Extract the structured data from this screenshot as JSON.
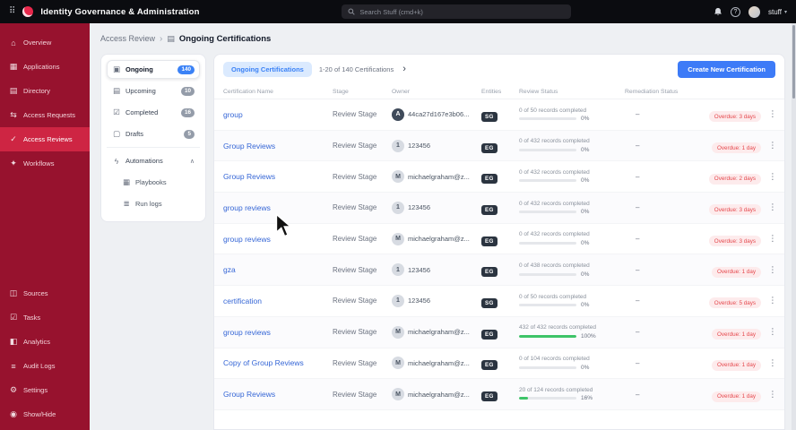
{
  "topbar": {
    "title": "Identity Governance & Administration",
    "search_placeholder": "Search Stuff (cmd+k)",
    "user_name": "stuff"
  },
  "sidebar": {
    "top": [
      {
        "label": "Overview",
        "icon": "overview-icon",
        "active": false
      },
      {
        "label": "Applications",
        "icon": "applications-icon",
        "active": false
      },
      {
        "label": "Directory",
        "icon": "directory-icon",
        "active": false
      },
      {
        "label": "Access Requests",
        "icon": "access-requests-icon",
        "active": false
      },
      {
        "label": "Access Reviews",
        "icon": "access-reviews-icon",
        "active": true
      },
      {
        "label": "Workflows",
        "icon": "workflows-icon",
        "active": false
      }
    ],
    "bottom": [
      {
        "label": "Sources",
        "icon": "sources-icon",
        "active": false
      },
      {
        "label": "Tasks",
        "icon": "tasks-icon",
        "active": false
      },
      {
        "label": "Analytics",
        "icon": "analytics-icon",
        "active": false
      },
      {
        "label": "Audit Logs",
        "icon": "audit-logs-icon",
        "active": false
      },
      {
        "label": "Settings",
        "icon": "settings-icon",
        "active": false
      },
      {
        "label": "Show/Hide",
        "icon": "show-hide-icon",
        "active": false
      }
    ]
  },
  "breadcrumb": {
    "parent": "Access Review",
    "current": "Ongoing Certifications"
  },
  "filters": {
    "items": [
      {
        "label": "Ongoing",
        "count": "140",
        "icon": "ongoing-icon",
        "active": true
      },
      {
        "label": "Upcoming",
        "count": "10",
        "icon": "upcoming-icon",
        "active": false
      },
      {
        "label": "Completed",
        "count": "16",
        "icon": "completed-icon",
        "active": false
      },
      {
        "label": "Drafts",
        "count": "5",
        "icon": "drafts-icon",
        "active": false
      }
    ],
    "automations": {
      "label": "Automations",
      "icon": "automations-icon",
      "expanded": true,
      "children": [
        {
          "label": "Playbooks",
          "icon": "playbooks-icon"
        },
        {
          "label": "Run logs",
          "icon": "runlogs-icon"
        }
      ]
    }
  },
  "table": {
    "tab_label": "Ongoing Certifications",
    "pagination": "1-20 of 140 Certifications",
    "create_button": "Create New Certification",
    "columns": [
      "Certification Name",
      "Stage",
      "Owner",
      "Entities",
      "Review Status",
      "Remediation Status"
    ],
    "rows": [
      {
        "name": "group",
        "stage": "Review Stage",
        "owner_initial": "A",
        "avatar_variant": "dark",
        "owner": "44ca27d167e3b06...",
        "entity": "SG",
        "review_text": "0 of 50 records completed",
        "percent": 0,
        "percent_label": "0%",
        "remediation": "–",
        "overdue": "Overdue: 3 days"
      },
      {
        "name": "Group Reviews",
        "stage": "Review Stage",
        "owner_initial": "1",
        "avatar_variant": "light",
        "owner": "123456",
        "entity": "EG",
        "review_text": "0 of 432 records completed",
        "percent": 0,
        "percent_label": "0%",
        "remediation": "–",
        "overdue": "Overdue: 1 day"
      },
      {
        "name": "Group Reviews",
        "stage": "Review Stage",
        "owner_initial": "M",
        "avatar_variant": "light",
        "owner": "michaelgraham@z...",
        "entity": "EG",
        "review_text": "0 of 432 records completed",
        "percent": 0,
        "percent_label": "0%",
        "remediation": "–",
        "overdue": "Overdue: 2 days"
      },
      {
        "name": "group reviews",
        "stage": "Review Stage",
        "owner_initial": "1",
        "avatar_variant": "light",
        "owner": "123456",
        "entity": "EG",
        "review_text": "0 of 432 records completed",
        "percent": 0,
        "percent_label": "0%",
        "remediation": "–",
        "overdue": "Overdue: 3 days"
      },
      {
        "name": "group reviews",
        "stage": "Review Stage",
        "owner_initial": "M",
        "avatar_variant": "light",
        "owner": "michaelgraham@z...",
        "entity": "EG",
        "review_text": "0 of 432 records completed",
        "percent": 0,
        "percent_label": "0%",
        "remediation": "–",
        "overdue": "Overdue: 3 days"
      },
      {
        "name": "gza",
        "stage": "Review Stage",
        "owner_initial": "1",
        "avatar_variant": "light",
        "owner": "123456",
        "entity": "EG",
        "review_text": "0 of 438 records completed",
        "percent": 0,
        "percent_label": "0%",
        "remediation": "–",
        "overdue": "Overdue: 1 day"
      },
      {
        "name": "certification",
        "stage": "Review Stage",
        "owner_initial": "1",
        "avatar_variant": "light",
        "owner": "123456",
        "entity": "SG",
        "review_text": "0 of 50 records completed",
        "percent": 0,
        "percent_label": "0%",
        "remediation": "–",
        "overdue": "Overdue: 5 days"
      },
      {
        "name": "group reviews",
        "stage": "Review Stage",
        "owner_initial": "M",
        "avatar_variant": "light",
        "owner": "michaelgraham@z...",
        "entity": "EG",
        "review_text": "432 of 432 records completed",
        "percent": 100,
        "percent_label": "100%",
        "remediation": "–",
        "overdue": "Overdue: 1 day"
      },
      {
        "name": "Copy of Group Reviews",
        "stage": "Review Stage",
        "owner_initial": "M",
        "avatar_variant": "light",
        "owner": "michaelgraham@z...",
        "entity": "EG",
        "review_text": "0 of 104 records completed",
        "percent": 0,
        "percent_label": "0%",
        "remediation": "–",
        "overdue": "Overdue: 1 day"
      },
      {
        "name": "Group Reviews",
        "stage": "Review Stage",
        "owner_initial": "M",
        "avatar_variant": "light",
        "owner": "michaelgraham@z...",
        "entity": "EG",
        "review_text": "20 of 124 records completed",
        "percent": 16,
        "percent_label": "16%",
        "remediation": "–",
        "overdue": "Overdue: 1 day"
      }
    ]
  },
  "colors": {
    "accent_blue": "#3b82f6",
    "sidebar_red": "#97122e",
    "sidebar_active_red": "#ce2543",
    "overdue_red": "#e5484d",
    "progress_green": "#3ec468",
    "topbar_black": "#0b0c10"
  }
}
